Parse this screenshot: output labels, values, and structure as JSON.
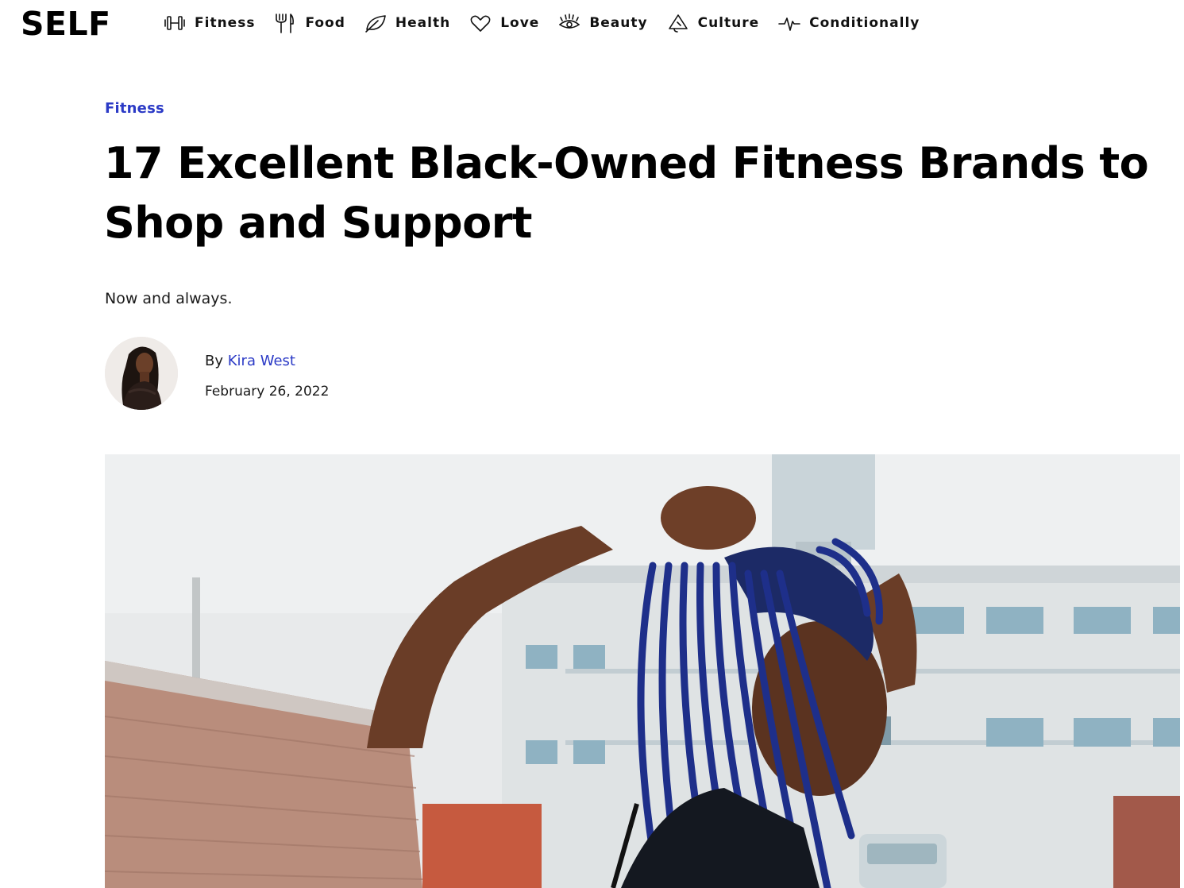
{
  "site": {
    "logo": "SELF"
  },
  "nav": {
    "items": [
      {
        "label": "Fitness",
        "icon": "dumbbell-icon"
      },
      {
        "label": "Food",
        "icon": "fork-knife-icon"
      },
      {
        "label": "Health",
        "icon": "leaf-icon"
      },
      {
        "label": "Love",
        "icon": "heart-icon"
      },
      {
        "label": "Beauty",
        "icon": "eye-lashes-icon"
      },
      {
        "label": "Culture",
        "icon": "megaphone-icon"
      },
      {
        "label": "Conditionally",
        "icon": "pulse-icon"
      }
    ]
  },
  "article": {
    "category": "Fitness",
    "headline": "17 Excellent Black-Owned Fitness Brands to Shop and Support",
    "dek": "Now and always.",
    "byline_prefix": "By",
    "author": "Kira West",
    "date": "February 26, 2022"
  },
  "colors": {
    "accent_link": "#2b3ac6",
    "text": "#111111",
    "background": "#ffffff"
  }
}
